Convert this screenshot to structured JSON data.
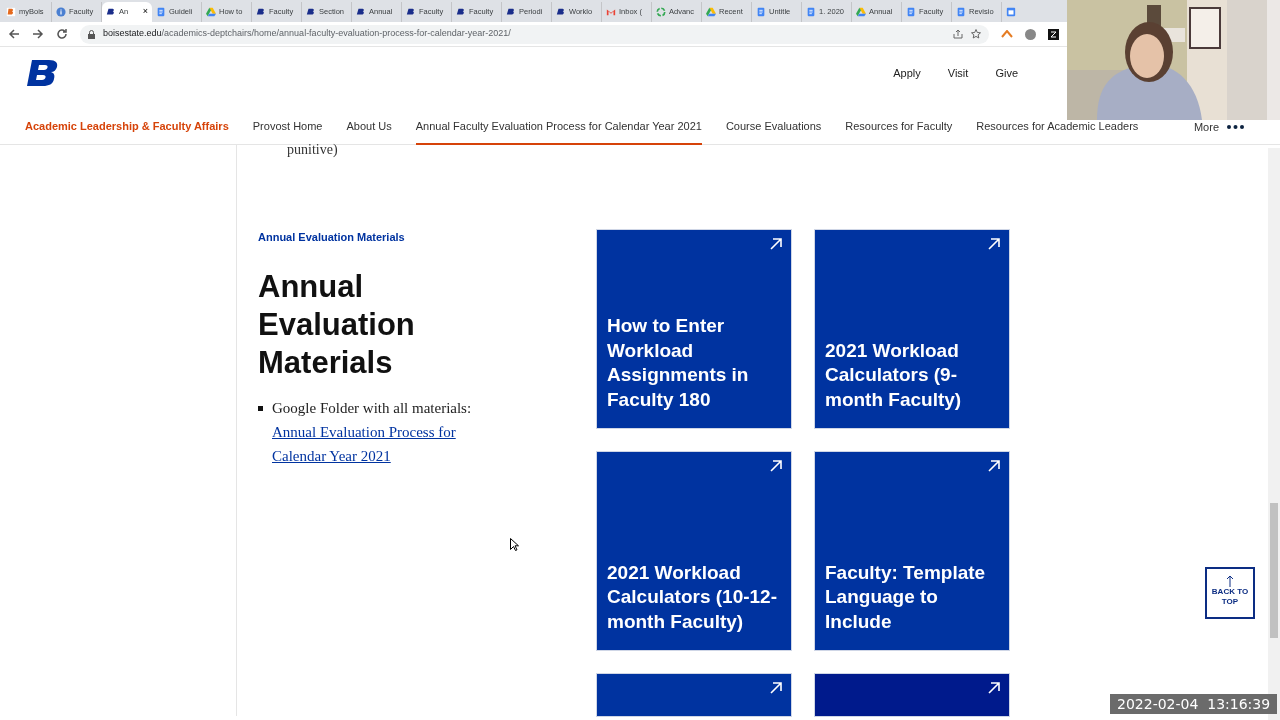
{
  "browser": {
    "tabs": [
      {
        "title": "myBois",
        "kind": "b-orange",
        "selected": false
      },
      {
        "title": "Faculty",
        "kind": "info",
        "selected": false
      },
      {
        "title": "An",
        "kind": "b",
        "selected": true,
        "close": "×"
      },
      {
        "title": "Guideli",
        "kind": "doc",
        "selected": false
      },
      {
        "title": "How to",
        "kind": "drive",
        "selected": false
      },
      {
        "title": "Faculty",
        "kind": "b",
        "selected": false
      },
      {
        "title": "Section",
        "kind": "b",
        "selected": false
      },
      {
        "title": "Annual",
        "kind": "b",
        "selected": false
      },
      {
        "title": "Faculty",
        "kind": "b",
        "selected": false
      },
      {
        "title": "Faculty",
        "kind": "b",
        "selected": false
      },
      {
        "title": "Periodi",
        "kind": "b",
        "selected": false
      },
      {
        "title": "Worklo",
        "kind": "b",
        "selected": false
      },
      {
        "title": "Inbox (",
        "kind": "gmail",
        "selected": false
      },
      {
        "title": "Advanc",
        "kind": "ring",
        "selected": false
      },
      {
        "title": "Recent",
        "kind": "drive",
        "selected": false
      },
      {
        "title": "Untitle",
        "kind": "doc",
        "selected": false
      },
      {
        "title": "1. 2020",
        "kind": "doc",
        "selected": false
      },
      {
        "title": "Annual",
        "kind": "drive",
        "selected": false
      },
      {
        "title": "Faculty",
        "kind": "doc",
        "selected": false
      },
      {
        "title": "Revisio",
        "kind": "doc",
        "selected": false
      },
      {
        "kind": "cal",
        "selected": false
      }
    ],
    "url_host": "boisestate.edu",
    "url_path": "/academics-deptchairs/home/annual-faculty-evaluation-process-for-calendar-year-2021/"
  },
  "site": {
    "top_links": [
      "Apply",
      "Visit",
      "Give"
    ],
    "brand": "Academic Leadership & Faculty Affairs",
    "nav": [
      {
        "label": "Provost Home",
        "selected": false
      },
      {
        "label": "About Us",
        "selected": false
      },
      {
        "label": "Annual Faculty Evaluation Process for Calendar Year 2021",
        "selected": true
      },
      {
        "label": "Course Evaluations",
        "selected": false
      },
      {
        "label": "Resources for Faculty",
        "selected": false
      },
      {
        "label": "Resources for Academic Leaders",
        "selected": false
      }
    ],
    "more": "More"
  },
  "content": {
    "cut_text": "punitive)",
    "eyebrow": "Annual Evaluation Materials",
    "heading": "Annual Evaluation Materials",
    "bullet": {
      "text": "Google Folder with all materials:",
      "link": "Annual Evaluation Process for Calendar Year 2021"
    },
    "tiles": [
      {
        "title": "How to Enter Workload Assignments in Faculty 180",
        "highlighted": false
      },
      {
        "title": "2021 Workload Calculators (9-month Faculty)",
        "highlighted": false
      },
      {
        "title": "2021 Workload Calculators (10-12-month Faculty)",
        "highlighted": false
      },
      {
        "title": "Faculty: Template Language to Include",
        "highlighted": false
      },
      {
        "highlighted": false
      },
      {
        "highlighted": true
      }
    ]
  },
  "back_to_top": "BACK TO TOP",
  "timestamp": "2022-02-04  13:16:39"
}
